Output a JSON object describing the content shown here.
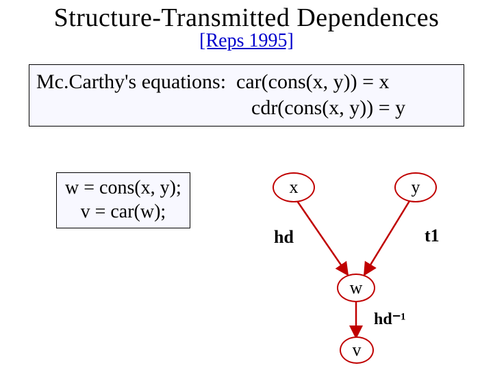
{
  "title": "Structure-Transmitted Dependences",
  "citation": "[Reps 1995]",
  "equations": {
    "heading": "Mc.Carthy's equations:",
    "eq1": "car(cons(x, y)) = x",
    "eq2": "cdr(cons(x, y)) = y"
  },
  "code": {
    "line1": "w = cons(x, y);",
    "line2": "v = car(w);"
  },
  "diagram": {
    "nodes": {
      "x": "x",
      "y": "y",
      "w": "w",
      "v": "v"
    },
    "edge_labels": {
      "hd": "hd",
      "t1": "t1",
      "hd_inv": "hd⁻¹"
    }
  }
}
